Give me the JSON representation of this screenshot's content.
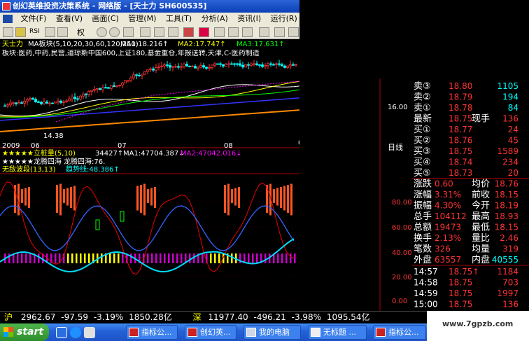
{
  "window": {
    "title": "创幻英维投资决策系统 - 网络版 - [天士力 SH600535]"
  },
  "menu": [
    "文件(F)",
    "查看(V)",
    "画面(C)",
    "管理(M)",
    "工具(T)",
    "分析(A)",
    "资讯(I)",
    "运行(R)"
  ],
  "toolbar": {
    "label_1": "RSI",
    "label_2": "权"
  },
  "price_panel": {
    "stock_name": "天士力",
    "ma_label": "MA板块(5,10,20,30,60,120,250)",
    "ma1": "MA1:18.216↑",
    "ma2": "MA2:17.747↑",
    "ma3": "MA3:17.631↑",
    "sector_text": "板块:医药,中药,民营,道琼斯中国600,上证180,基金重仓,年报送转,天津,C-医药制造",
    "price_tick": "16.00",
    "low_label": "14.38",
    "x_labels": [
      "2009",
      "06",
      "07",
      "08",
      "09"
    ],
    "period": "日线"
  },
  "indicator1": {
    "name": "★★★★★立桩量(5,10)",
    "value": "34427↑",
    "ma1": "MA1:47704.387↓",
    "ma2": "MA2:47042.016↓",
    "line2": "★★★★★龙腾四海 龙腾四海:76."
  },
  "indicator2": {
    "name": "无敌波段(13,13)",
    "trend": "趋势线:48.386↑",
    "ticks": [
      "80.00",
      "60.00",
      "40.00",
      "20.00",
      "0.00"
    ]
  },
  "quote": {
    "sells": [
      {
        "label": "卖③",
        "price": "18.80",
        "vol": "1105"
      },
      {
        "label": "卖②",
        "price": "18.79",
        "vol": "194"
      },
      {
        "label": "卖①",
        "price": "18.78",
        "vol": "84"
      }
    ],
    "latest": {
      "label": "最新",
      "price": "18.75",
      "label2": "现手",
      "vol": "136"
    },
    "buys": [
      {
        "label": "买①",
        "price": "18.77",
        "vol": "24"
      },
      {
        "label": "买②",
        "price": "18.76",
        "vol": "45"
      },
      {
        "label": "买③",
        "price": "18.75",
        "vol": "1589"
      },
      {
        "label": "买④",
        "price": "18.74",
        "vol": "234"
      },
      {
        "label": "买⑤",
        "price": "18.73",
        "vol": "20"
      }
    ],
    "stats": [
      {
        "l1": "涨跌",
        "v1": "0.60",
        "l2": "均价",
        "v2": "18.76"
      },
      {
        "l1": "涨幅",
        "v1": "3.31%",
        "l2": "前收",
        "v2": "18.15"
      },
      {
        "l1": "振幅",
        "v1": "4.30%",
        "l2": "今开",
        "v2": "18.19"
      },
      {
        "l1": "总手",
        "v1": "104112",
        "l2": "最高",
        "v2": "18.93"
      },
      {
        "l1": "总额",
        "v1": "19473",
        "l2": "最低",
        "v2": "18.15"
      },
      {
        "l1": "换手",
        "v1": "2.13%",
        "l2": "量比",
        "v2": "2.46"
      },
      {
        "l1": "笔数",
        "v1": "326",
        "l2": "均量",
        "v2": "319"
      }
    ],
    "outer": {
      "l1": "外盘",
      "v1": "63557",
      "l2": "内盘",
      "v2": "40555"
    },
    "ticks": [
      {
        "time": "14:57",
        "price": "18.75",
        "arrow": "↑",
        "vol": "1184"
      },
      {
        "time": "14:58",
        "price": "18.75",
        "arrow": "",
        "vol": "703"
      },
      {
        "time": "14:59",
        "price": "18.75",
        "arrow": "",
        "vol": "1997"
      },
      {
        "time": "15:00",
        "price": "18.75",
        "arrow": "",
        "vol": "136"
      }
    ],
    "scroll_text": "价格热点指标订阅成长"
  },
  "status": {
    "sh_label": "沪",
    "sh_index": "2962.67",
    "sh_change": "-97.59",
    "sh_pct": "-3.19%",
    "sh_amount": "1850.28亿",
    "sz_label": "深",
    "sz_index": "11977.40",
    "sz_change": "-496.21",
    "sz_pct": "-3.98%",
    "sz_amount": "1095.54亿"
  },
  "taskbar": {
    "start": "start",
    "tasks": [
      "指标公...",
      "创幻英...",
      "我的电脑",
      "无标题 ...",
      "指标公..."
    ]
  },
  "watermark": "www.7gpzb.com"
}
